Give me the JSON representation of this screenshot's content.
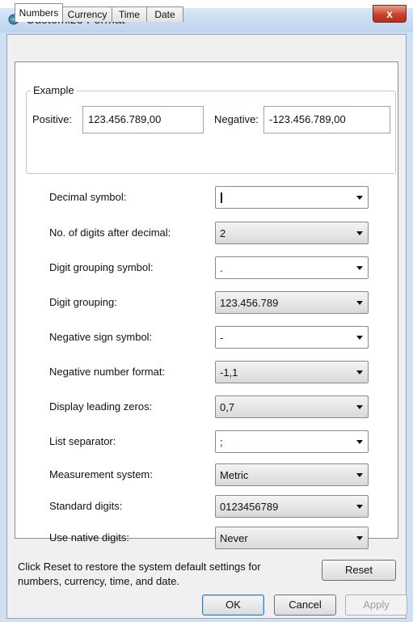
{
  "window": {
    "title": "Customize Format",
    "close_label": "x",
    "icon": "globe-gear-icon"
  },
  "tabs": [
    {
      "label": "Numbers",
      "active": true
    },
    {
      "label": "Currency",
      "active": false
    },
    {
      "label": "Time",
      "active": false
    },
    {
      "label": "Date",
      "active": false
    }
  ],
  "example": {
    "group_label": "Example",
    "positive_label": "Positive:",
    "positive_value": "123.456.789,00",
    "negative_label": "Negative:",
    "negative_value": "-123.456.789,00"
  },
  "settings": [
    {
      "label": "Decimal symbol:",
      "value": "",
      "kind": "edit"
    },
    {
      "label": "No. of digits after decimal:",
      "value": "2",
      "kind": "list"
    },
    {
      "label": "Digit grouping symbol:",
      "value": ".",
      "kind": "edit"
    },
    {
      "label": "Digit grouping:",
      "value": "123.456.789",
      "kind": "list"
    },
    {
      "label": "Negative sign symbol:",
      "value": "-",
      "kind": "edit"
    },
    {
      "label": "Negative number format:",
      "value": "-1,1",
      "kind": "list"
    },
    {
      "label": "Display leading zeros:",
      "value": "0,7",
      "kind": "list"
    },
    {
      "label": "List separator:",
      "value": ";",
      "kind": "edit"
    },
    {
      "label": "Measurement system:",
      "value": "Metric",
      "kind": "list"
    },
    {
      "label": "Standard digits:",
      "value": "0123456789",
      "kind": "list"
    },
    {
      "label": "Use native digits:",
      "value": "Never",
      "kind": "list"
    }
  ],
  "footer": {
    "reset_note": "Click Reset to restore the system default settings for numbers, currency, time, and date.",
    "reset_label": "Reset",
    "ok_label": "OK",
    "cancel_label": "Cancel",
    "apply_label": "Apply"
  },
  "colors": {
    "titlebar": "#bdd3ee",
    "close_button": "#c9422b",
    "panel": "#ffffff",
    "dialog": "#f0f0f0"
  }
}
